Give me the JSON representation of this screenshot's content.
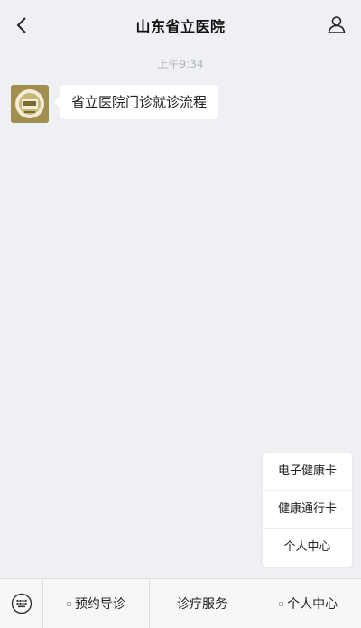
{
  "header": {
    "title": "山东省立医院",
    "back_icon": "chevron-left-icon",
    "profile_icon": "user-icon"
  },
  "chat": {
    "timestamp": "上午9:34",
    "messages": [
      {
        "sender_avatar": "hospital-logo",
        "text": "省立医院门诊就诊流程"
      }
    ]
  },
  "submenu": {
    "items": [
      {
        "label": "电子健康卡"
      },
      {
        "label": "健康通行卡"
      },
      {
        "label": "个人中心"
      }
    ]
  },
  "bottom_menu": {
    "keyboard_icon": "keyboard-icon",
    "tabs": [
      {
        "label": "预约导诊",
        "has_submenu": true
      },
      {
        "label": "诊疗服务",
        "has_submenu": false
      },
      {
        "label": "个人中心",
        "has_submenu": true
      }
    ]
  },
  "colors": {
    "background": "#eef0f3",
    "bubble": "#ffffff",
    "timestamp": "#b1b4b8"
  }
}
